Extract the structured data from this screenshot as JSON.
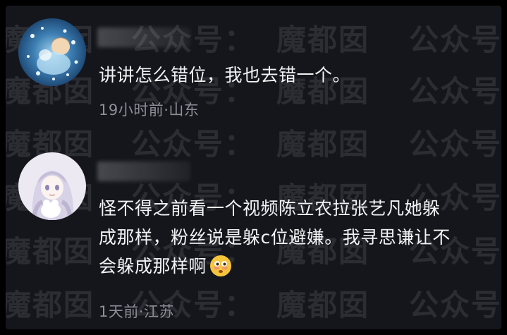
{
  "watermark": {
    "text_site": "魔都囡",
    "text_account": "公众号",
    "rows": [
      [
        "魔都囡",
        "公众号：",
        "魔都囡",
        "公众号"
      ],
      [
        "魔都囡",
        "公众号：",
        "魔都囡",
        "公众号"
      ],
      [
        "魔都囡",
        "公众号：",
        "魔都囡",
        "公众号"
      ],
      [
        "魔都囡",
        "公众号：",
        "魔都囡",
        "公众号"
      ],
      [
        "魔都囡",
        "公众号：",
        "魔都囡",
        "公众号"
      ],
      [
        "魔都囡",
        "公众号：",
        "魔都囡",
        "公众号"
      ]
    ]
  },
  "comments": [
    {
      "text_line_1": "讲讲怎么错位，我也去错一个。",
      "meta": "19小时前·山东"
    },
    {
      "text_line_1": "怪不得之前看一个视频陈立农拉张艺凡她躲",
      "text_line_2": "成那样，粉丝说是躲c位避嫌。我寻思谦让不",
      "text_line_3": "会躲成那样啊",
      "emoji": "flushed-face-emoji",
      "meta": "1天前·江苏"
    }
  ],
  "colors": {
    "background": "#15161c",
    "text": "#f2f2f4",
    "meta": "#8d8f98"
  }
}
